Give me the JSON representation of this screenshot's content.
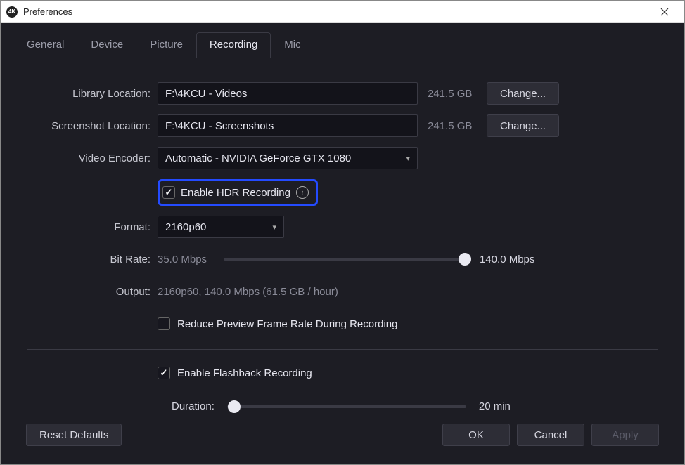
{
  "window": {
    "title": "Preferences"
  },
  "tabs": [
    "General",
    "Device",
    "Picture",
    "Recording",
    "Mic"
  ],
  "active_tab": "Recording",
  "labels": {
    "library_location": "Library Location:",
    "screenshot_location": "Screenshot Location:",
    "video_encoder": "Video Encoder:",
    "format": "Format:",
    "bit_rate": "Bit Rate:",
    "output": "Output:",
    "duration": "Duration:"
  },
  "library": {
    "path": "F:\\4KCU - Videos",
    "size": "241.5 GB",
    "change": "Change..."
  },
  "screenshot": {
    "path": "F:\\4KCU - Screenshots",
    "size": "241.5 GB",
    "change": "Change..."
  },
  "encoder": {
    "value": "Automatic - NVIDIA GeForce GTX 1080"
  },
  "hdr": {
    "label": "Enable HDR Recording",
    "checked": true
  },
  "format": {
    "value": "2160p60"
  },
  "bitrate": {
    "min": "35.0 Mbps",
    "max": "140.0 Mbps",
    "pos_pct": 98
  },
  "output": {
    "text": "2160p60, 140.0 Mbps (61.5 GB / hour)"
  },
  "reduce_preview": {
    "label": "Reduce Preview Frame Rate During Recording",
    "checked": false
  },
  "flashback": {
    "label": "Enable Flashback Recording",
    "checked": true,
    "duration_label": "20 min",
    "duration_pos_pct": 3
  },
  "footer": {
    "reset": "Reset Defaults",
    "ok": "OK",
    "cancel": "Cancel",
    "apply": "Apply"
  }
}
